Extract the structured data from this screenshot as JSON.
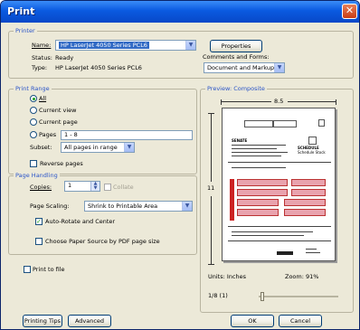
{
  "window": {
    "title": "Print",
    "close_glyph": "✕"
  },
  "printer": {
    "group_label": "Printer",
    "name_label": "Name:",
    "name_value": "HP LaserJet 4050 Series PCL6",
    "status_label": "Status:",
    "status_value": "Ready",
    "type_label": "Type:",
    "type_value": "HP LaserJet 4050 Series PCL6",
    "properties_button": "Properties",
    "comments_label": "Comments and Forms:",
    "comments_value": "Document and Markups"
  },
  "print_range": {
    "group_label": "Print Range",
    "options": [
      "All",
      "Current view",
      "Current page",
      "Pages"
    ],
    "pages_value": "1 - 8",
    "subset_label": "Subset:",
    "subset_value": "All pages in range",
    "reverse_label": "Reverse pages"
  },
  "page_handling": {
    "group_label": "Page Handling",
    "copies_label": "Copies:",
    "copies_value": "1",
    "collate_label": "Collate",
    "scaling_label": "Page Scaling:",
    "scaling_value": "Shrink to Printable Area",
    "auto_rotate_label": "Auto-Rotate and Center",
    "choose_source_label": "Choose Paper Source by PDF page size"
  },
  "print_to_file_label": "Print to file",
  "preview": {
    "group_label": "Preview: Composite",
    "width_label": "8.5",
    "height_label": "11",
    "units_label": "Units: Inches",
    "zoom_label": "Zoom: 91%",
    "page_indicator": "1/8 (1)",
    "doc_heading": "SENATE",
    "doc_title_line1": "SCHEDULE",
    "doc_title_line2": "Schedule Stock",
    "icons": {
      "ruler": "ruler-icon",
      "dropdown": "chevron-down-icon",
      "spinner": "spinner-arrows-icon"
    },
    "slider_position": 0
  },
  "footer": {
    "printing_tips_button": "Printing Tips",
    "advanced_button": "Advanced",
    "ok_button": "OK",
    "cancel_button": "Cancel"
  },
  "colors": {
    "title_bar": "#0a5ae0",
    "group_label": "#2a54c8",
    "highlight": "#316ac5",
    "form_pink": "#e9a3ae",
    "form_red": "#cc2222"
  }
}
